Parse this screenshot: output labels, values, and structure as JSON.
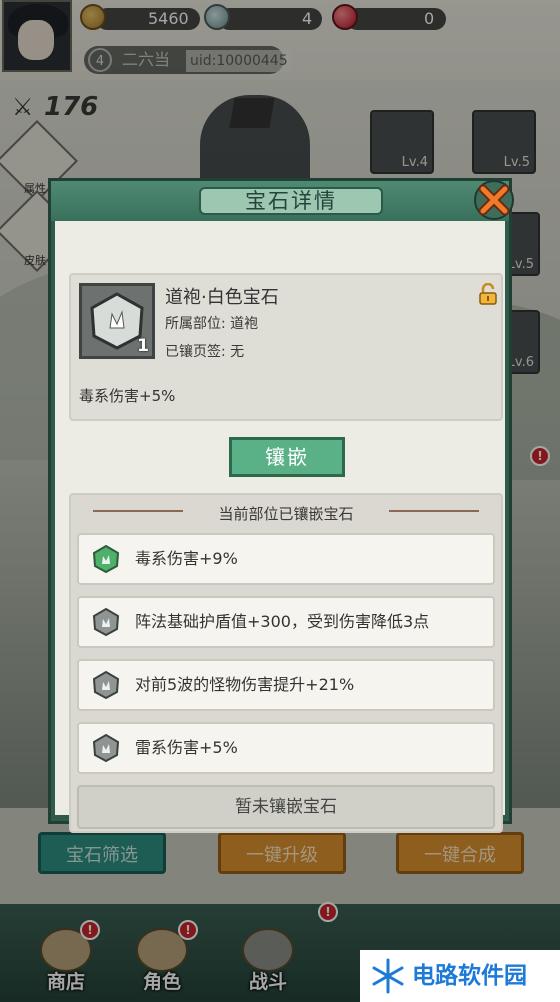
{
  "resources": {
    "coins": "5460",
    "crystals": "4",
    "rubies": "0"
  },
  "player": {
    "level": "4",
    "name": "二六当",
    "uid": "uid:10000445"
  },
  "power": "176",
  "side_buttons": [
    "属性",
    "皮肤"
  ],
  "equipment": [
    {
      "level": "Lv.4"
    },
    {
      "level": "Lv.5"
    },
    {
      "level": "Lv.5"
    },
    {
      "level": "Lv.6"
    }
  ],
  "bottom_buttons": {
    "filter": "宝石筛选",
    "upgrade": "一键升级",
    "merge": "一键合成"
  },
  "nav": [
    {
      "label": "商店",
      "badge": "!"
    },
    {
      "label": "角色",
      "badge": "!"
    },
    {
      "label": "战斗",
      "badge": "!"
    }
  ],
  "modal": {
    "title": "宝石详情",
    "gem": {
      "name": "道袍·白色宝石",
      "count": "1",
      "part": "所属部位:  道袍",
      "page": "已镶页签:  无",
      "effect": "毒系伤害+5%"
    },
    "inlay_label": "镶嵌",
    "slots_title": "当前部位已镶嵌宝石",
    "slots": [
      {
        "text": "毒系伤害+9%",
        "gem": "green-gem-icon"
      },
      {
        "text": "阵法基础护盾值+300，受到伤害降低3点",
        "gem": "gray-gem-icon"
      },
      {
        "text": "对前5波的怪物伤害提升+21%",
        "gem": "gray-gem-icon"
      },
      {
        "text": "雷系伤害+5%",
        "gem": "gray-gem-icon"
      }
    ],
    "empty_slot": "暂未镶嵌宝石"
  },
  "watermark": "电路软件园",
  "colors": {
    "modal_frame": "#2f5b4b",
    "inlay_button": "#5ab087",
    "accent_red": "#c9252c"
  }
}
